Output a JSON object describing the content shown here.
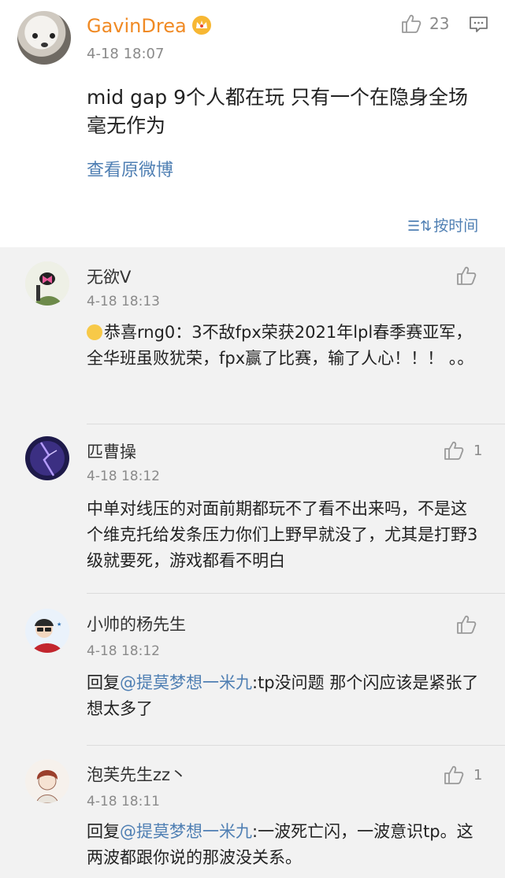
{
  "post": {
    "username": "GavinDrea",
    "time": "4-18 18:07",
    "like_count": "23",
    "text": "mid gap 9个人都在玩 只有一个在隐身全场毫无作为",
    "view_original": "查看原微博",
    "sort_label": "按时间",
    "sort_icon": "☰⇅"
  },
  "replies": [
    {
      "username": "无欲V",
      "time": "4-18 18:13",
      "like_count": "",
      "text": "恭喜rng0：3不敌fpx荣获2021年lpl春季赛亚军，全华班虽败犹荣，fpx赢了比赛，输了人心！！！ 。。"
    },
    {
      "username": "匹曹操",
      "time": "4-18 18:12",
      "like_count": "1",
      "text": "中单对线压的对面前期都玩不了看不出来吗，不是这个维克托给发条压力你们上野早就没了，尤其是打野3级就要死，游戏都看不明白"
    },
    {
      "username": "小帅的杨先生",
      "time": "4-18 18:12",
      "like_count": "",
      "reply_prefix": "回复",
      "mention": "@提莫梦想一米九",
      "text": ":tp没问题 那个闪应该是紧张了想太多了"
    },
    {
      "username": "泡芙先生zz丶",
      "time": "4-18 18:11",
      "like_count": "1",
      "reply_prefix": "回复",
      "mention": "@提莫梦想一米九",
      "text": ":一波死亡闪，一波意识tp。这两波都跟你说的那波没关系。"
    }
  ],
  "colors": {
    "accent_blue": "#4f7fb3",
    "username_orange": "#f08a24",
    "meta_gray": "#8a8a8a",
    "background": "#f2f2f2"
  }
}
